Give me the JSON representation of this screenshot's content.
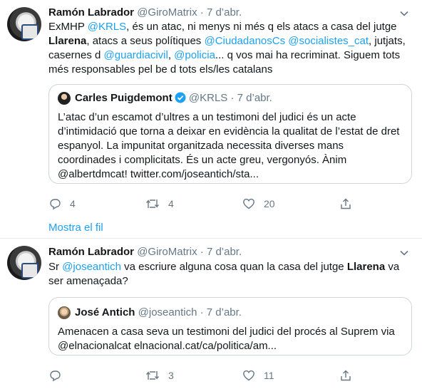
{
  "tweet1": {
    "author_name": "Ramón Labrador",
    "handle": "@GiroMatrix",
    "sep": "·",
    "time": "7 d’abr.",
    "text_parts": [
      {
        "t": "ExMHP ",
        "k": "plain"
      },
      {
        "t": "@KRLS",
        "k": "mention"
      },
      {
        "t": ", és un atac, ni menys ni més q els atacs a casa del jutge ",
        "k": "plain"
      },
      {
        "t": "Llarena",
        "k": "bold"
      },
      {
        "t": ", atacs a seus polítiques ",
        "k": "plain"
      },
      {
        "t": "@CiudadanosCs",
        "k": "mention"
      },
      {
        "t": " ",
        "k": "plain"
      },
      {
        "t": "@socialistes_cat",
        "k": "mention"
      },
      {
        "t": ", jutjats, casernes d ",
        "k": "plain"
      },
      {
        "t": "@guardiacivil",
        "k": "mention"
      },
      {
        "t": ", ",
        "k": "plain"
      },
      {
        "t": "@policia",
        "k": "mention"
      },
      {
        "t": "... q vos mai ha recriminat. Siguem tots més responsables pel be d tots els/les catalans",
        "k": "plain"
      }
    ],
    "quote": {
      "author_name": "Carles Puigdemont",
      "handle": "@KRLS",
      "sep": "·",
      "time": "7 d’abr.",
      "text": "L’atac d’un escamot d’ultres a un testimoni del judici és un acte d’intimidació que torna a deixar en evidència la qualitat de l’estat de dret espanyol. La impunitat organitzada necessita diverses mans coordinades i complicitats. És un acte greu, vergonyós. Ànim @albertdmcat! twitter.com/joseantich/sta..."
    },
    "actions": {
      "replies": "4",
      "retweets": "4",
      "likes": "20"
    },
    "show_thread": "Mostra el fil"
  },
  "tweet2": {
    "author_name": "Ramón Labrador",
    "handle": "@GiroMatrix",
    "sep": "·",
    "time": "7 d’abr.",
    "text_parts": [
      {
        "t": "Sr ",
        "k": "plain"
      },
      {
        "t": "@joseantich",
        "k": "mention"
      },
      {
        "t": " va escriure alguna cosa quan la casa del jutge ",
        "k": "plain"
      },
      {
        "t": "Llarena",
        "k": "bold"
      },
      {
        "t": " va ser amenaçada?",
        "k": "plain"
      }
    ],
    "quote": {
      "author_name": "José Antich",
      "handle": "@joseantich",
      "sep": "·",
      "time": "7 d’abr.",
      "text": "Amenacen a casa seva un testimoni del judici del procés al Suprem via @elnacionalcat elnacional.cat/ca/politica/am..."
    },
    "actions": {
      "replies": "",
      "retweets": "3",
      "likes": "11"
    }
  },
  "colors": {
    "accent": "#1da1f2",
    "muted": "#657786",
    "border": "#ccd6dd"
  }
}
